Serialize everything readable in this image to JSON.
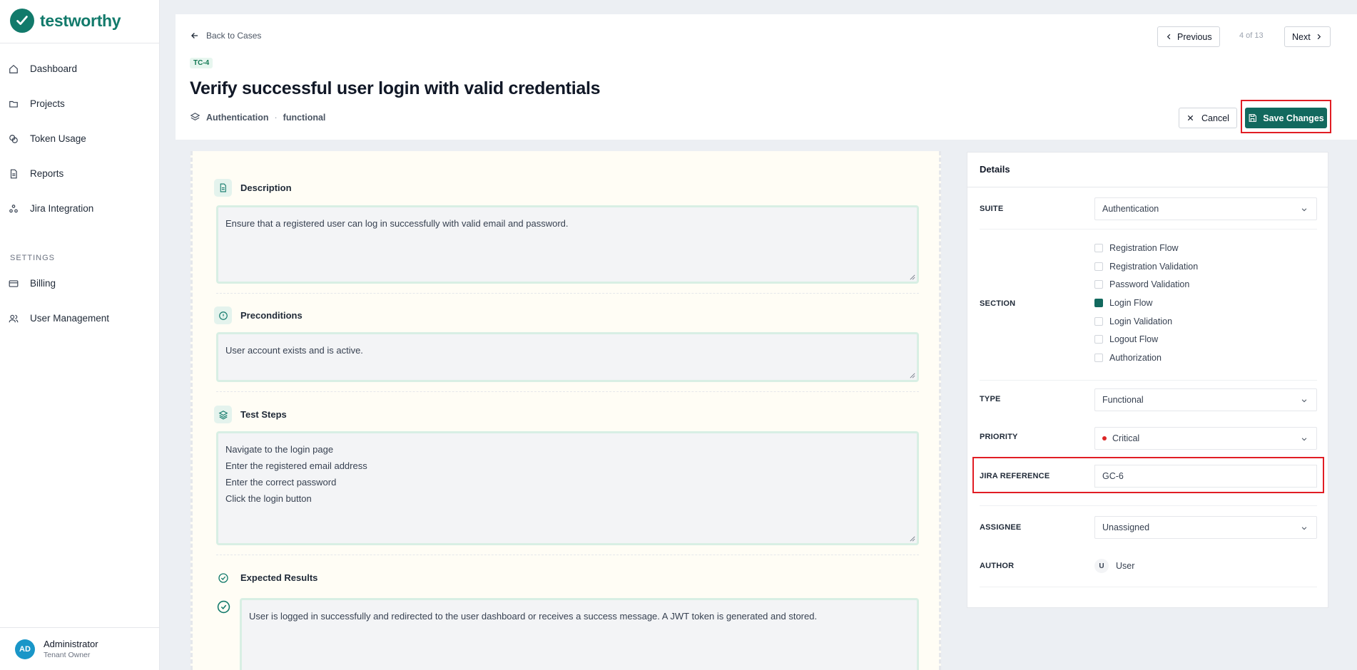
{
  "brand": {
    "name": "testworthy",
    "color": "#127a6b"
  },
  "sidebar": {
    "items": [
      {
        "label": "Dashboard",
        "icon": "home-icon"
      },
      {
        "label": "Projects",
        "icon": "folder-icon"
      },
      {
        "label": "Token Usage",
        "icon": "coins-icon"
      },
      {
        "label": "Reports",
        "icon": "file-icon"
      },
      {
        "label": "Jira Integration",
        "icon": "network-icon"
      }
    ],
    "settings_label": "SETTINGS",
    "settings_items": [
      {
        "label": "Billing",
        "icon": "card-icon"
      },
      {
        "label": "User Management",
        "icon": "users-icon"
      }
    ],
    "user": {
      "initials": "AD",
      "name": "Administrator",
      "role": "Tenant Owner"
    }
  },
  "header": {
    "back_label": "Back to Cases",
    "case_id": "TC-4",
    "title": "Verify successful user login with valid credentials",
    "suite": "Authentication",
    "type": "functional",
    "previous_label": "Previous",
    "page_count": "4 of 13",
    "next_label": "Next",
    "cancel_label": "Cancel",
    "save_label": "Save Changes"
  },
  "content": {
    "description_label": "Description",
    "description": "Ensure that a registered user can log in successfully with valid email and password.",
    "preconditions_label": "Preconditions",
    "preconditions": "User account exists and is active.",
    "steps_label": "Test Steps",
    "steps": [
      "Navigate to the login page",
      "Enter the registered email address",
      "Enter the correct password",
      "Click the login button"
    ],
    "expected_label": "Expected Results",
    "expected": "User is logged in successfully and redirected to the user dashboard or receives a success message. A JWT token is generated and stored."
  },
  "details": {
    "title": "Details",
    "suite_label": "SUITE",
    "suite_value": "Authentication",
    "section_label": "SECTION",
    "sections": [
      {
        "label": "Registration Flow",
        "checked": false
      },
      {
        "label": "Registration Validation",
        "checked": false
      },
      {
        "label": "Password Validation",
        "checked": false
      },
      {
        "label": "Login Flow",
        "checked": true
      },
      {
        "label": "Login Validation",
        "checked": false
      },
      {
        "label": "Logout Flow",
        "checked": false
      },
      {
        "label": "Authorization",
        "checked": false
      }
    ],
    "type_label": "TYPE",
    "type_value": "Functional",
    "priority_label": "PRIORITY",
    "priority_value": "Critical",
    "priority_color": "#dc2626",
    "jira_label": "JIRA REFERENCE",
    "jira_value": "GC-6",
    "assignee_label": "ASSIGNEE",
    "assignee_value": "Unassigned",
    "author_label": "AUTHOR",
    "author_initial": "U",
    "author_value": "User"
  },
  "highlight_color": "#e11d24"
}
